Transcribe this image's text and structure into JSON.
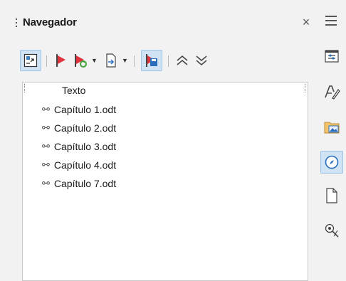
{
  "navigator": {
    "title": "Navegador",
    "close_glyph": "×",
    "tree": {
      "root": "Texto",
      "link_glyph": "⚯",
      "items": [
        "Capítulo 1.odt",
        "Capítulo 2.odt",
        "Capítulo 3.odt",
        "Capítulo 4.odt",
        "Capítulo 7.odt"
      ]
    },
    "toolbar_icons": [
      "toggle-icon",
      "promote-chapter-icon",
      "demote-chapter-icon",
      "insert-icon",
      "save-contents-icon",
      "promote-level-icon",
      "demote-level-icon"
    ]
  },
  "sidebar": {
    "icons": [
      "properties-icon",
      "styles-icon",
      "gallery-icon",
      "navigator-icon",
      "page-icon",
      "style-inspector-icon"
    ],
    "active": "navigator-icon"
  },
  "colors": {
    "accent": "#cfe3f5",
    "accent_border": "#9ec3e6",
    "flag_red": "#e0343c",
    "flag_green": "#3fa535",
    "save_blue": "#2a6ebd"
  }
}
